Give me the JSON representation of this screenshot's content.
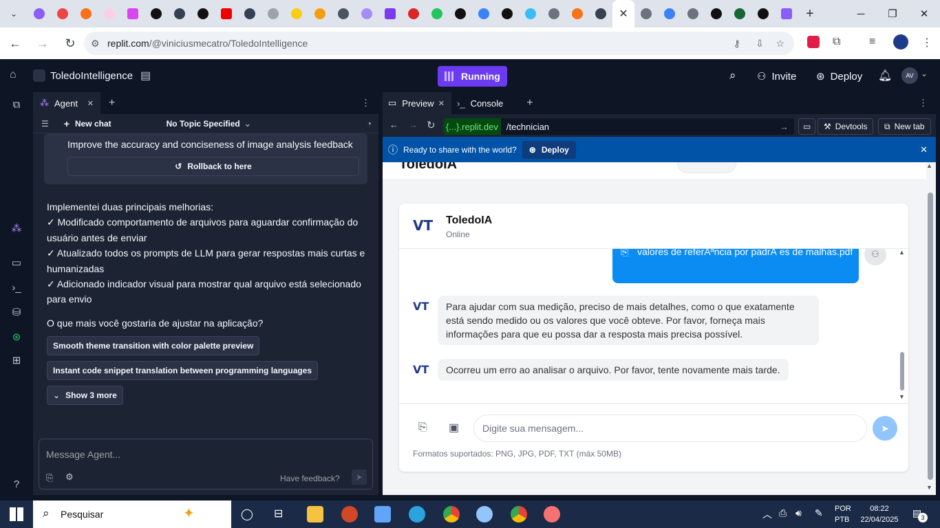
{
  "browser": {
    "url_domain": "replit.com",
    "url_path": "/@viniciusmecatro/ToledoIntelligence",
    "close_tab_glyph": "✕"
  },
  "replit": {
    "project_name": "ToledoIntelligence",
    "run_status": "Running",
    "invite_label": "Invite",
    "deploy_label": "Deploy",
    "avatar_initials": "AV"
  },
  "agent": {
    "tab_label": "Agent",
    "new_chat_label": "New chat",
    "topic_label": "No Topic Specified",
    "checkpoint_text": "Improve the accuracy and conciseness of image analysis feedback",
    "rollback_label": "Rollback to here",
    "message_lines": [
      "Implementei duas principais melhorias:",
      "✓ Modificado comportamento de arquivos para aguardar confirmação do usuário antes de enviar",
      "✓ Atualizado todos os prompts de LLM para gerar respostas mais curtas e humanizadas",
      "✓ Adicionado indicador visual para mostrar qual arquivo está selecionado para envio"
    ],
    "question": "O que mais você gostaria de ajustar na aplicação?",
    "suggestions": [
      "Smooth theme transition with color palette preview",
      "Instant code snippet translation between programming languages"
    ],
    "show_more_label": "Show 3 more",
    "input_placeholder": "Message Agent...",
    "feedback_label": "Have feedback?"
  },
  "preview": {
    "tab_preview": "Preview",
    "tab_console": "Console",
    "domain_label": "{...}.replit.dev",
    "path": "/technician",
    "devtools_label": "Devtools",
    "newtab_label": "New tab",
    "deploy_prompt": "Ready to share with the world?",
    "deploy_btn": "Deploy"
  },
  "app": {
    "header_title": "ToledoIA",
    "chat_title": "ToledoIA",
    "chat_status": "Online",
    "logo_text": "VT",
    "user_file_msg": "valores de referÃªncia por padrÃ es de malhas.pdf",
    "bot_msg_1": "Para ajudar com sua medição, preciso de mais detalhes, como o que exatamente está sendo medido ou os valores que você obteve. Por favor, forneça mais informações para que eu possa dar a resposta mais precisa possível.",
    "bot_msg_2": "Ocorreu um erro ao analisar o arquivo. Por favor, tente novamente mais tarde.",
    "input_placeholder": "Digite sua mensagem...",
    "formats_note": "Formatos suportados: PNG, JPG, PDF, TXT (máx 50MB)"
  },
  "taskbar": {
    "search_placeholder": "Pesquisar",
    "lang_top": "POR",
    "lang_bottom": "PTB",
    "time": "08:22",
    "date": "22/04/2025",
    "notif_count": "3"
  }
}
